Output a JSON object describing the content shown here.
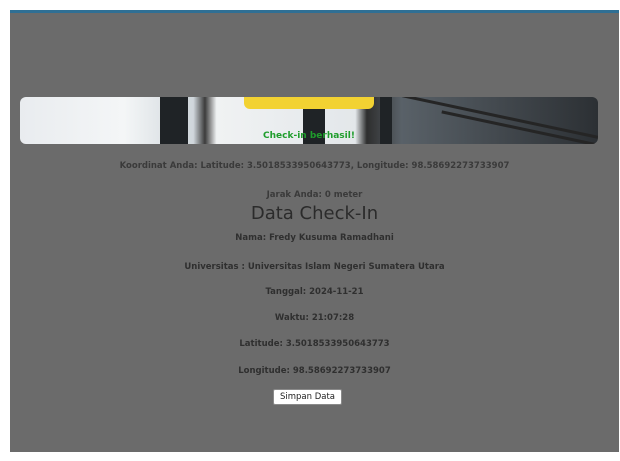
{
  "checkin": {
    "message": "Check-in berhasil!",
    "coordinates": "Koordinat Anda: Latitude: 3.5018533950643773, Longitude: 98.58692273733907",
    "distance": "Jarak Anda: 0 meter"
  },
  "data_section": {
    "title": "Data Check-In",
    "nama": "Nama: Fredy Kusuma Ramadhani",
    "universitas": "Universitas : Universitas Islam Negeri Sumatera Utara",
    "tanggal": "Tanggal: 2024-11-21",
    "waktu": "Waktu: 21:07:28",
    "latitude": "Latitude: 3.5018533950643773",
    "longitude": "Longitude: 98.58692273733907"
  },
  "actions": {
    "save_label": "Simpan Data"
  },
  "colors": {
    "overlay": "#6b6b6b",
    "header_accent": "#2f6f94",
    "success_text": "#1f9d2c",
    "camera_yellow": "#f2d232"
  }
}
